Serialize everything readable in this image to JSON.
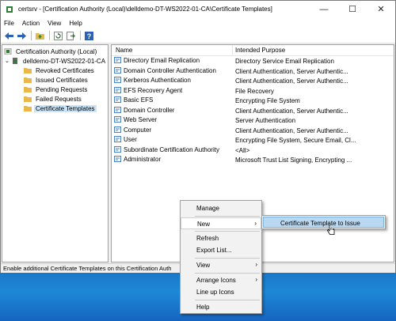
{
  "window": {
    "title": "certsrv - [Certification Authority (Local)\\delldemo-DT-WS2022-01-CA\\Certificate Templates]",
    "controls": {
      "minimize": "—",
      "maximize": "☐",
      "close": "✕"
    }
  },
  "menu": [
    "File",
    "Action",
    "View",
    "Help"
  ],
  "tree": {
    "root": "Certification Authority (Local)",
    "ca": "delldemo-DT-WS2022-01-CA",
    "items": [
      "Revoked Certificates",
      "Issued Certificates",
      "Pending Requests",
      "Failed Requests",
      "Certificate Templates"
    ],
    "selected": "Certificate Templates"
  },
  "list": {
    "columns": [
      "Name",
      "Intended Purpose"
    ],
    "rows": [
      {
        "name": "Directory Email Replication",
        "purpose": "Directory Service Email Replication"
      },
      {
        "name": "Domain Controller Authentication",
        "purpose": "Client Authentication, Server Authentic..."
      },
      {
        "name": "Kerberos Authentication",
        "purpose": "Client Authentication, Server Authentic..."
      },
      {
        "name": "EFS Recovery Agent",
        "purpose": "File Recovery"
      },
      {
        "name": "Basic EFS",
        "purpose": "Encrypting File System"
      },
      {
        "name": "Domain Controller",
        "purpose": "Client Authentication, Server Authentic..."
      },
      {
        "name": "Web Server",
        "purpose": "Server Authentication"
      },
      {
        "name": "Computer",
        "purpose": "Client Authentication, Server Authentic..."
      },
      {
        "name": "User",
        "purpose": "Encrypting File System, Secure Email, Cl..."
      },
      {
        "name": "Subordinate Certification Authority",
        "purpose": "<All>"
      },
      {
        "name": "Administrator",
        "purpose": "Microsoft Trust List Signing, Encrypting ..."
      }
    ]
  },
  "status": "Enable additional Certificate Templates on this Certification Auth",
  "context_menu": {
    "items": [
      "Manage",
      "New",
      "Refresh",
      "Export List...",
      "View",
      "Arrange Icons",
      "Line up Icons",
      "Help"
    ],
    "highlighted": "New",
    "submenu_arrow": "›"
  },
  "submenu": {
    "item": "Certificate Template to Issue"
  },
  "icons": {
    "app": "certsrv-icon",
    "folder_color": "#e8b84a",
    "cert_color": "#4a7fc1"
  }
}
